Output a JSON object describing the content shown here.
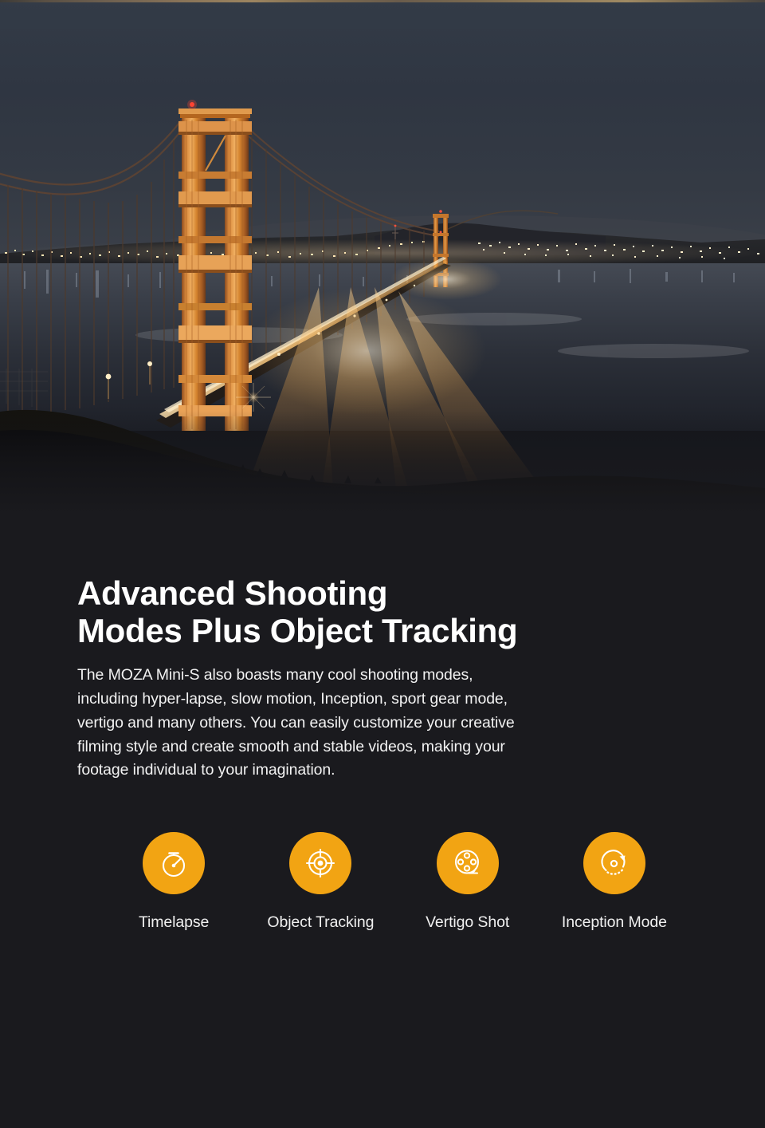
{
  "hero": {
    "alt": "Golden Gate Bridge at night with city lights and long-exposure light trails",
    "scene": "golden-gate-bridge-night"
  },
  "heading": "Advanced Shooting\nModes Plus Object Tracking",
  "paragraph": "The MOZA Mini-S also boasts many cool shooting modes,\nincluding hyper-lapse, slow motion, Inception, sport gear mode,\n vertigo and many others. You can easily customize your creative\nfilming style and create smooth and stable videos, making your\nfootage individual to your imagination.",
  "features": [
    {
      "label": "Timelapse",
      "icon": "stopwatch-icon"
    },
    {
      "label": "Object Tracking",
      "icon": "crosshair-target-icon"
    },
    {
      "label": "Vertigo Shot",
      "icon": "film-reel-icon"
    },
    {
      "label": "Inception Mode",
      "icon": "rotate-arrow-icon"
    }
  ],
  "colors": {
    "background": "#1a1a1e",
    "accent_orange": "#f2a413",
    "text_primary": "#ffffff",
    "text_body": "#f2f2f2",
    "sky": "#2e3642",
    "bridge_orange": "#c9762f"
  }
}
